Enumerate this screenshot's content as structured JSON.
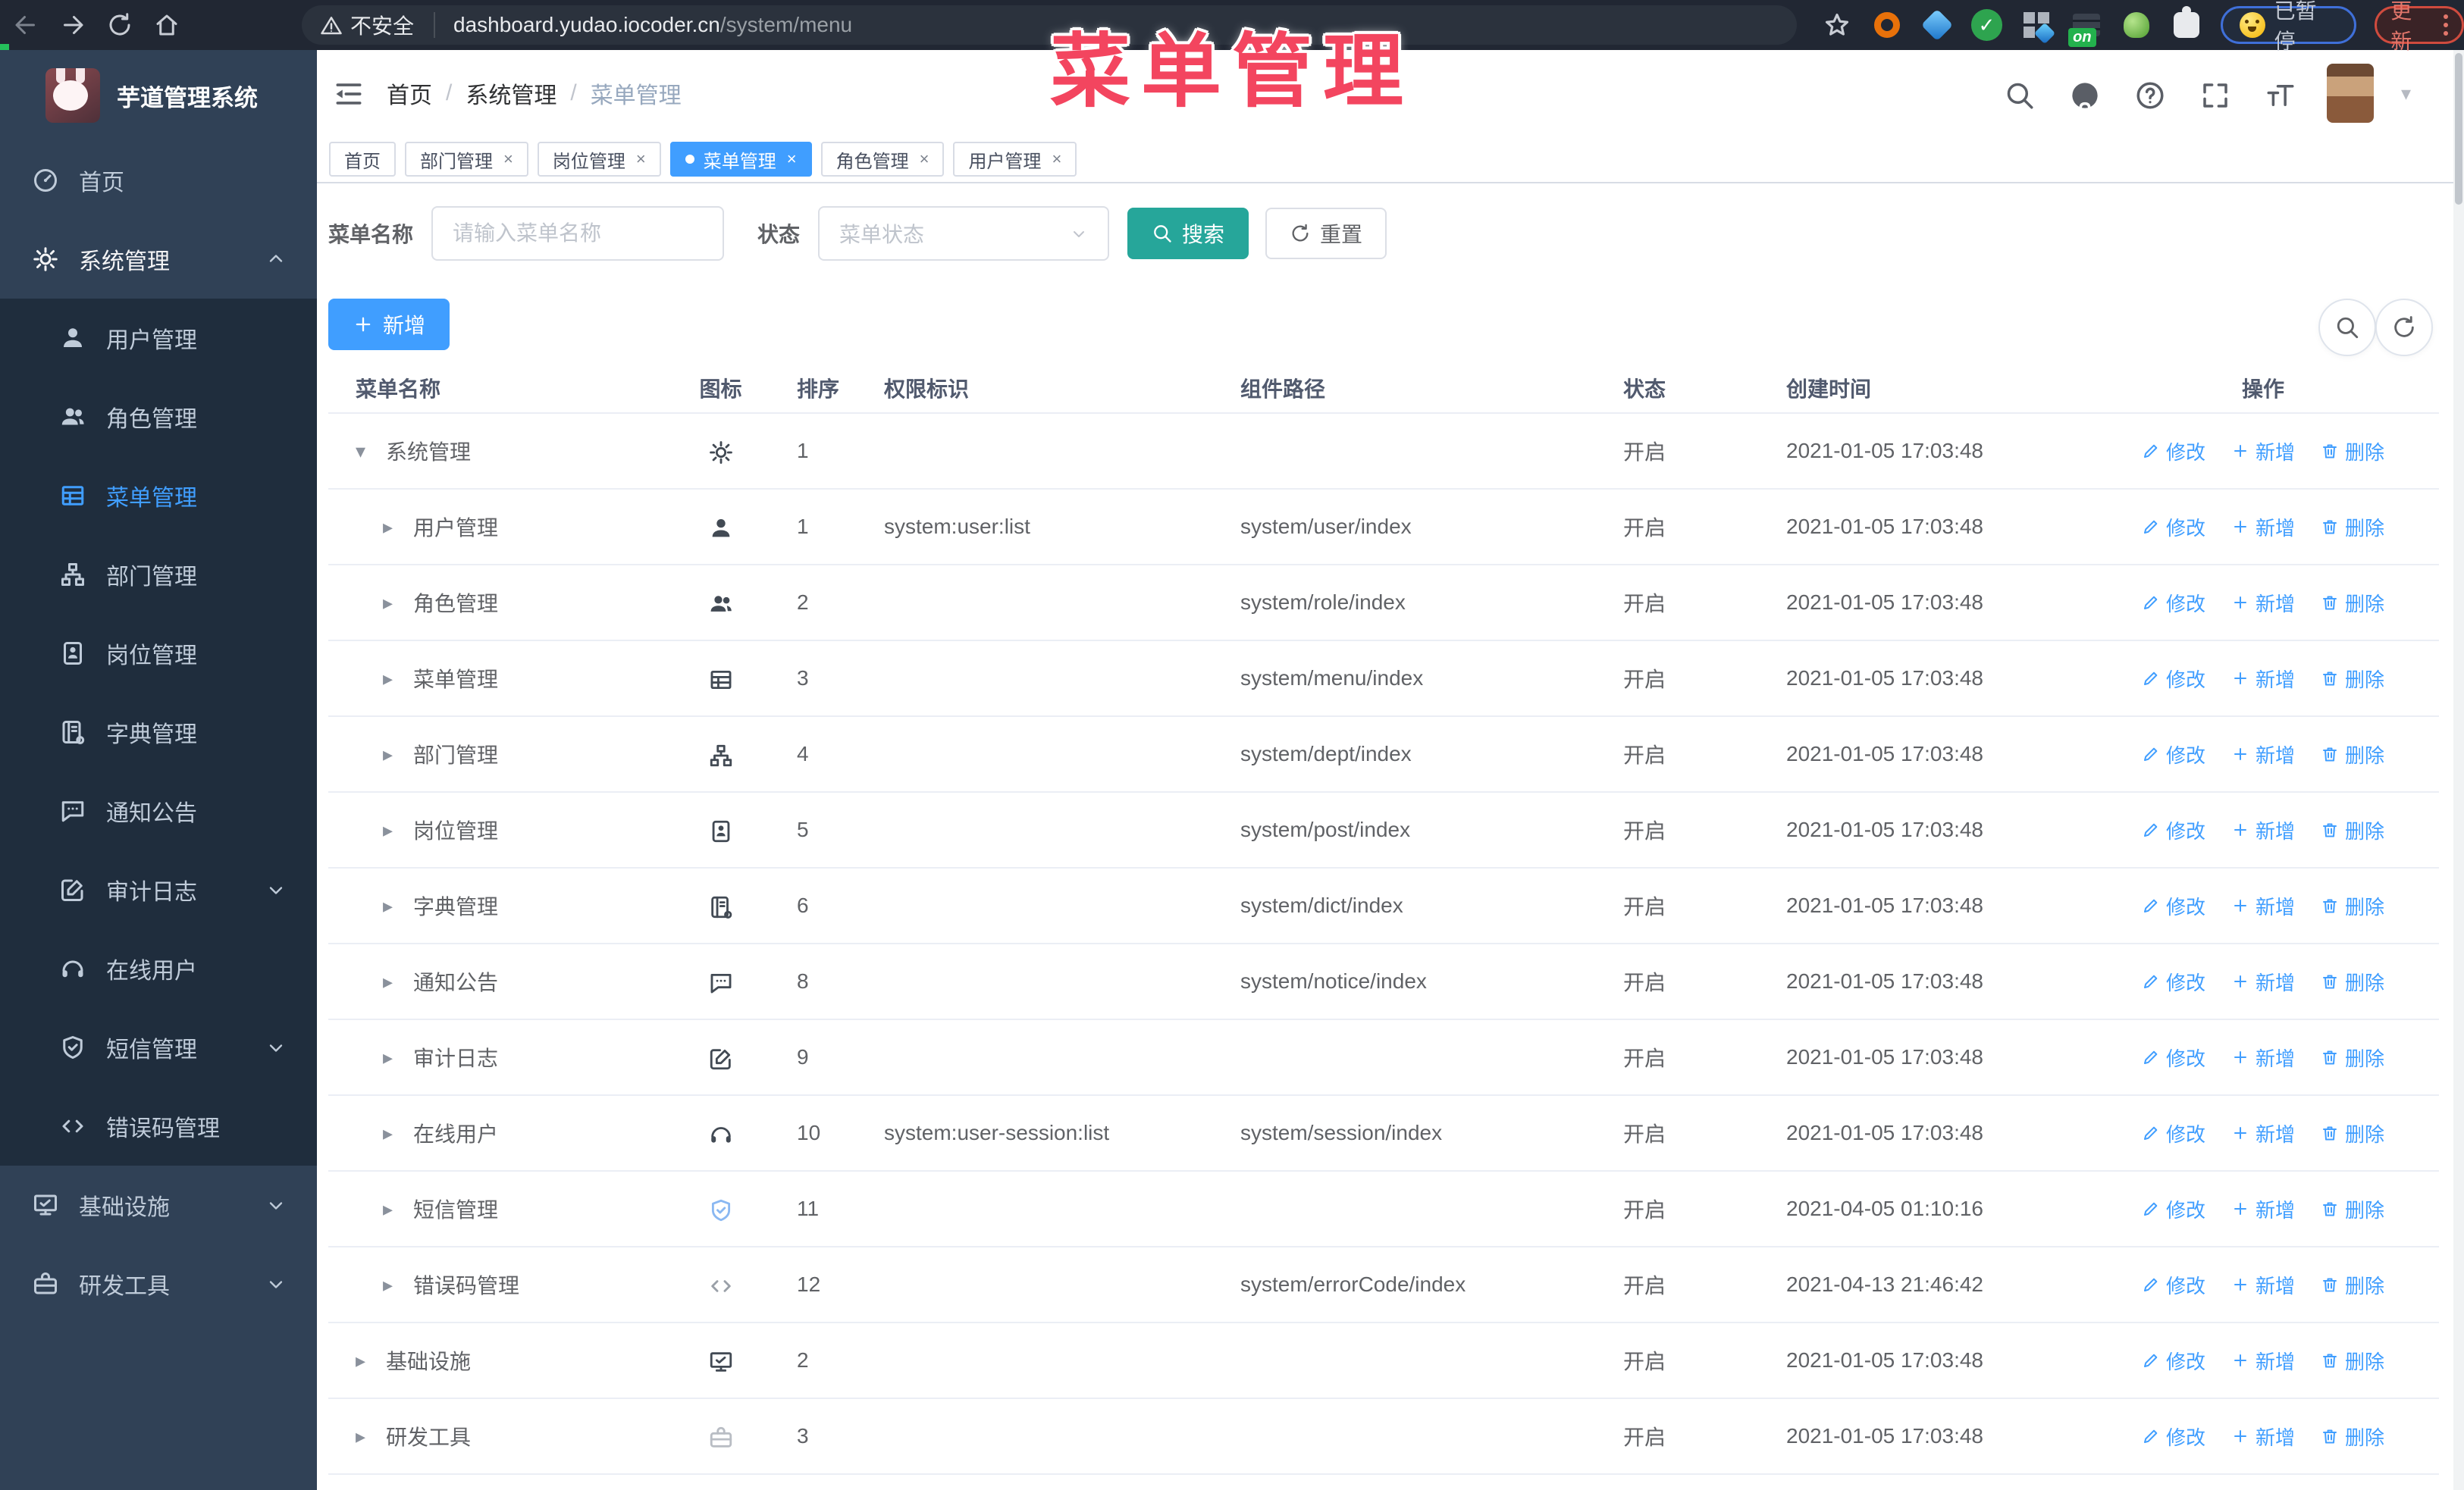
{
  "browser": {
    "security_label": "不安全",
    "url_host": "dashboard.yudao.iocoder.cn",
    "url_path": "/system/menu",
    "paused_badge": "已暂停",
    "update_button": "更新",
    "server_ext_badge": "on",
    "extensions": [
      "orange-ring",
      "blue-gem",
      "green-check",
      "grid-gem",
      "server-on",
      "green-key",
      "puzzle"
    ]
  },
  "watermark": "菜单管理",
  "sidebar": {
    "logo_title": "芋道管理系统",
    "items": [
      {
        "key": "home",
        "label": "首页",
        "icon": "dashboard",
        "type": "top"
      },
      {
        "key": "system",
        "label": "系统管理",
        "icon": "gear",
        "type": "parent",
        "chevron": "up"
      },
      {
        "key": "user",
        "label": "用户管理",
        "icon": "user",
        "type": "sub"
      },
      {
        "key": "role",
        "label": "角色管理",
        "icon": "users",
        "type": "sub"
      },
      {
        "key": "menu",
        "label": "菜单管理",
        "icon": "treetable",
        "type": "sub",
        "active": true
      },
      {
        "key": "dept",
        "label": "部门管理",
        "icon": "tree",
        "type": "sub"
      },
      {
        "key": "post",
        "label": "岗位管理",
        "icon": "badge",
        "type": "sub"
      },
      {
        "key": "dict",
        "label": "字典管理",
        "icon": "book",
        "type": "sub"
      },
      {
        "key": "notice",
        "label": "通知公告",
        "icon": "comment",
        "type": "sub"
      },
      {
        "key": "audit",
        "label": "审计日志",
        "icon": "edit",
        "type": "sub",
        "chevron": "down"
      },
      {
        "key": "online",
        "label": "在线用户",
        "icon": "headset",
        "type": "sub"
      },
      {
        "key": "sms",
        "label": "短信管理",
        "icon": "shield",
        "type": "sub",
        "chevron": "down"
      },
      {
        "key": "errcode",
        "label": "错误码管理",
        "icon": "code",
        "type": "sub"
      },
      {
        "key": "infra",
        "label": "基础设施",
        "icon": "monitor",
        "type": "top",
        "chevron": "down"
      },
      {
        "key": "devtool",
        "label": "研发工具",
        "icon": "toolbox",
        "type": "top",
        "chevron": "down"
      }
    ]
  },
  "breadcrumb": {
    "items": [
      "首页",
      "系统管理",
      "菜单管理"
    ]
  },
  "tabs": [
    {
      "key": "home",
      "label": "首页",
      "closable": false,
      "active": false
    },
    {
      "key": "dept",
      "label": "部门管理",
      "closable": true,
      "active": false
    },
    {
      "key": "post",
      "label": "岗位管理",
      "closable": true,
      "active": false
    },
    {
      "key": "menu",
      "label": "菜单管理",
      "closable": true,
      "active": true
    },
    {
      "key": "role",
      "label": "角色管理",
      "closable": true,
      "active": false
    },
    {
      "key": "user",
      "label": "用户管理",
      "closable": true,
      "active": false
    }
  ],
  "search": {
    "name_label": "菜单名称",
    "name_placeholder": "请输入菜单名称",
    "name_value": "",
    "status_label": "状态",
    "status_placeholder": "菜单状态",
    "search_button": "搜索",
    "reset_button": "重置"
  },
  "toolbar": {
    "add_button": "新增"
  },
  "table": {
    "columns": [
      "菜单名称",
      "图标",
      "排序",
      "权限标识",
      "组件路径",
      "状态",
      "创建时间",
      "操作"
    ],
    "action_labels": {
      "edit": "修改",
      "add": "新增",
      "delete": "删除"
    },
    "rows": [
      {
        "name": "系统管理",
        "level": 0,
        "expand": "down",
        "icon": "gear",
        "sort": "1",
        "perm": "",
        "path": "",
        "status": "开启",
        "created": "2021-01-05 17:03:48"
      },
      {
        "name": "用户管理",
        "level": 1,
        "expand": "right",
        "icon": "user",
        "sort": "1",
        "perm": "system:user:list",
        "path": "system/user/index",
        "status": "开启",
        "created": "2021-01-05 17:03:48"
      },
      {
        "name": "角色管理",
        "level": 1,
        "expand": "right",
        "icon": "users",
        "sort": "2",
        "perm": "",
        "path": "system/role/index",
        "status": "开启",
        "created": "2021-01-05 17:03:48"
      },
      {
        "name": "菜单管理",
        "level": 1,
        "expand": "right",
        "icon": "treetable",
        "sort": "3",
        "perm": "",
        "path": "system/menu/index",
        "status": "开启",
        "created": "2021-01-05 17:03:48"
      },
      {
        "name": "部门管理",
        "level": 1,
        "expand": "right",
        "icon": "tree",
        "sort": "4",
        "perm": "",
        "path": "system/dept/index",
        "status": "开启",
        "created": "2021-01-05 17:03:48"
      },
      {
        "name": "岗位管理",
        "level": 1,
        "expand": "right",
        "icon": "badge",
        "sort": "5",
        "perm": "",
        "path": "system/post/index",
        "status": "开启",
        "created": "2021-01-05 17:03:48"
      },
      {
        "name": "字典管理",
        "level": 1,
        "expand": "right",
        "icon": "book",
        "sort": "6",
        "perm": "",
        "path": "system/dict/index",
        "status": "开启",
        "created": "2021-01-05 17:03:48"
      },
      {
        "name": "通知公告",
        "level": 1,
        "expand": "right",
        "icon": "comment",
        "sort": "8",
        "perm": "",
        "path": "system/notice/index",
        "status": "开启",
        "created": "2021-01-05 17:03:48"
      },
      {
        "name": "审计日志",
        "level": 1,
        "expand": "right",
        "icon": "edit",
        "sort": "9",
        "perm": "",
        "path": "",
        "status": "开启",
        "created": "2021-01-05 17:03:48"
      },
      {
        "name": "在线用户",
        "level": 1,
        "expand": "right",
        "icon": "headset",
        "sort": "10",
        "perm": "system:user-session:list",
        "path": "system/session/index",
        "status": "开启",
        "created": "2021-01-05 17:03:48"
      },
      {
        "name": "短信管理",
        "level": 1,
        "expand": "right",
        "icon": "shield",
        "tone": "tone-blue",
        "sort": "11",
        "perm": "",
        "path": "",
        "status": "开启",
        "created": "2021-04-05 01:10:16"
      },
      {
        "name": "错误码管理",
        "level": 1,
        "expand": "right",
        "icon": "code",
        "tone": "tone-mid",
        "sort": "12",
        "perm": "",
        "path": "system/errorCode/index",
        "status": "开启",
        "created": "2021-04-13 21:46:42"
      },
      {
        "name": "基础设施",
        "level": 0,
        "expand": "right",
        "icon": "monitor",
        "sort": "2",
        "perm": "",
        "path": "",
        "status": "开启",
        "created": "2021-01-05 17:03:48"
      },
      {
        "name": "研发工具",
        "level": 0,
        "expand": "right",
        "icon": "toolbox",
        "tone": "tone-light",
        "sort": "3",
        "perm": "",
        "path": "",
        "status": "开启",
        "created": "2021-01-05 17:03:48"
      }
    ]
  }
}
